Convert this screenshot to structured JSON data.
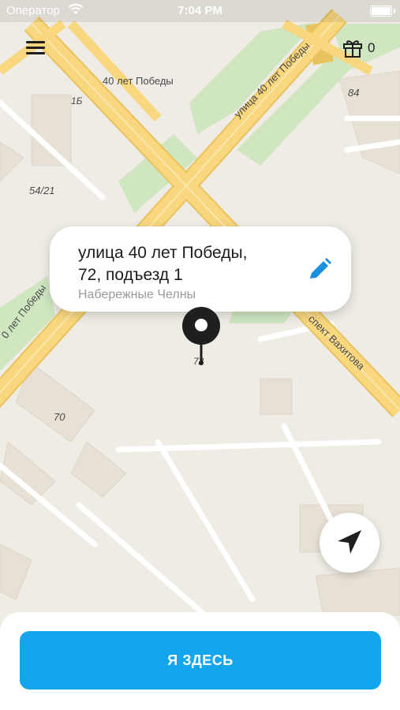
{
  "status_bar": {
    "carrier": "Оператор",
    "time": "7:04 PM"
  },
  "header": {
    "menu_icon": "hamburger-menu-icon",
    "gift_icon": "gift-icon",
    "gift_count": "0"
  },
  "map": {
    "labels": {
      "area_name": "40 лет Победы",
      "building_1b": "1Б",
      "building_84": "84",
      "building_54_21": "54/21",
      "street_40_let": "улица 40 лет Победы",
      "street_40_let_left": "0 лет Победы",
      "prospekt_vakhitova": "спект Вахитова",
      "building_72": "72",
      "building_70": "70"
    },
    "colors": {
      "road": "#f8d77f",
      "road_edge": "#e9c25e",
      "park": "#cfe6c0",
      "block": "#e8e2d8",
      "ground": "#efece5"
    }
  },
  "address_card": {
    "line1": "улица 40 лет Победы,",
    "line2": "72, подъезд 1",
    "city": "Набережные Челны",
    "edit_icon": "pencil-icon"
  },
  "locate_icon": "navigation-arrow-icon",
  "primary_button": {
    "label": "Я ЗДЕСЬ",
    "color": "#13a6ec"
  }
}
